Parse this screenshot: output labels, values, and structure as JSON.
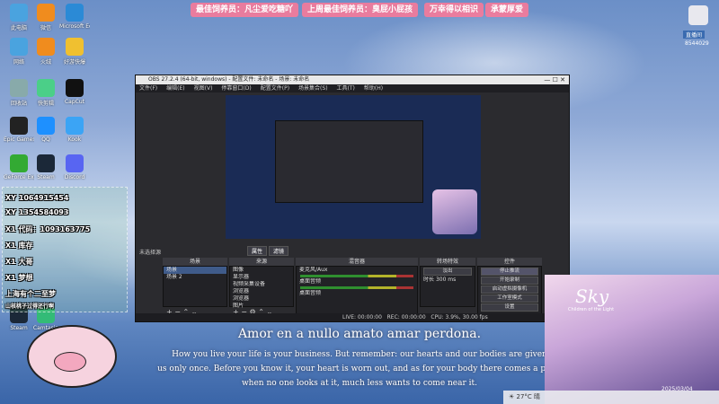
{
  "desktop": {
    "icons": [
      {
        "label": "此电脑",
        "color": "#4aa3df"
      },
      {
        "label": "微信",
        "color": "#f08c1e"
      },
      {
        "label": "Microsoft Edge",
        "color": "#2b8ad6"
      },
      {
        "label": "网络",
        "color": "#4aa3df"
      },
      {
        "label": "火绒",
        "color": "#f08c1e"
      },
      {
        "label": "好游快爆",
        "color": "#f0c030"
      },
      {
        "label": "回收站",
        "color": "#8aa"
      },
      {
        "label": "快剪辑",
        "color": "#4bcf88"
      },
      {
        "label": "CapCut",
        "color": "#111"
      },
      {
        "label": "Epic Games Launcher",
        "color": "#222"
      },
      {
        "label": "QQ",
        "color": "#1e90ff"
      },
      {
        "label": "Kook",
        "color": "#3ba4f5"
      },
      {
        "label": "GeForce Experience",
        "color": "#3a3"
      },
      {
        "label": "Steam",
        "color": "#1b2838"
      },
      {
        "label": "Discord",
        "color": "#5865f2"
      },
      {
        "label": "Steam",
        "color": "#1b2838"
      },
      {
        "label": "Camtasia",
        "color": "#3b7"
      }
    ]
  },
  "ticker": [
    "最佳饲养员：凡尘爱吃糖吖",
    "上周最佳饲养员：臭屁小屁孩",
    "万幸得以相识",
    "承蒙厚爱"
  ],
  "streamer": {
    "badge": "直播间",
    "id": "8544029"
  },
  "obs": {
    "title": "OBS 27.2.4 (64-bit, windows) - 配置文件: 未命名 - 场景: 未命名",
    "menu": [
      "文件(F)",
      "编辑(E)",
      "视图(V)",
      "停靠窗口(D)",
      "配置文件(P)",
      "场景集合(S)",
      "工具(T)",
      "帮助(H)"
    ],
    "no_source": "未选择源",
    "props_label": "属性",
    "filter_label": "滤镜",
    "panels": {
      "scenes": "场景",
      "sources": "来源",
      "mixer": "混音器",
      "transitions": "转场特效",
      "controls": "控件"
    },
    "scenes": [
      "场景",
      "场景 2"
    ],
    "sources": [
      "图像",
      "显示器",
      "视频采集设备",
      "浏览器",
      "浏览器",
      "图片"
    ],
    "mixer": [
      {
        "name": "麦克风/Aux",
        "db": "0.0 dB"
      },
      {
        "name": "桌面音频",
        "db": "0.0 dB"
      },
      {
        "name": "桌面音频",
        "db": "0.0 dB"
      }
    ],
    "transition": {
      "type": "淡出",
      "duration_label": "时长",
      "duration": "300 ms"
    },
    "controls": [
      "停止推流",
      "开始录制",
      "启动虚拟摄像机",
      "工作室模式",
      "设置",
      "退出"
    ],
    "status": {
      "live": "LIVE: 00:00:00",
      "rec": "REC: 00:00:00",
      "cpu": "CPU: 3.9%, 30.00 fps",
      "dropped": "延迟 0/0 (0.0%)"
    }
  },
  "lyrics": {
    "line1": "Amor en a nullo amato amar perdona.",
    "line2": "How you live your life is your business. But remember: our hearts and our bodies are given",
    "line3": "us only once. Before you know it, your heart is worn out, and as for your body there comes a point",
    "line4": "when no one looks at it, much less wants to come near it."
  },
  "chat": [
    "XY  1064915454",
    "XY  1354584093",
    "X1  代码：1093163775",
    "X1  库存",
    "X1  大哥",
    "X1  梦想",
    "上海有个二至梦",
    "山核桃子过得还行啊"
  ],
  "sky": {
    "title": "Sky",
    "subtitle": "Children of the Light",
    "credit": "2025/03/04"
  },
  "weather": {
    "temp": "27°C",
    "label": "晴"
  }
}
